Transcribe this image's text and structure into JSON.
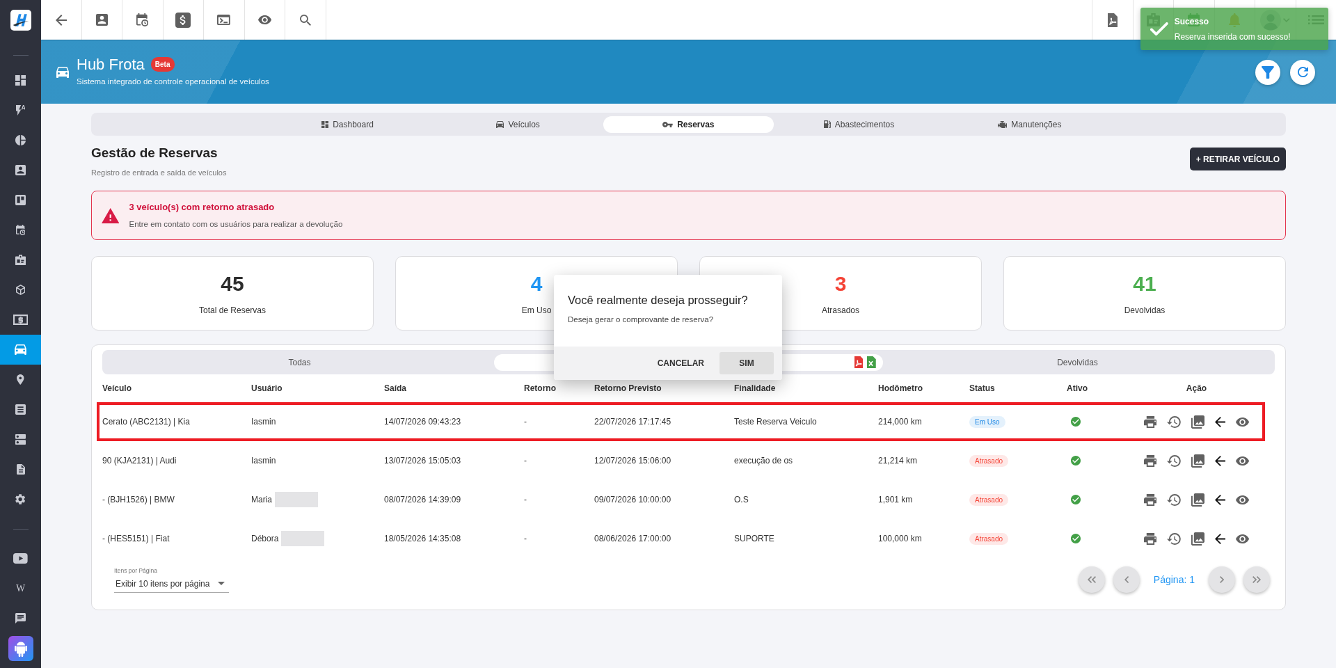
{
  "sidebar": {
    "items": [
      {
        "selected": false
      },
      {
        "selected": false
      },
      {
        "selected": false
      },
      {
        "selected": false
      },
      {
        "selected": false
      },
      {
        "selected": false
      },
      {
        "selected": false
      },
      {
        "selected": false
      },
      {
        "selected": false
      },
      {
        "selected": true
      },
      {
        "selected": false
      },
      {
        "selected": false
      },
      {
        "selected": false
      },
      {
        "selected": false
      },
      {
        "selected": false
      }
    ],
    "extra_items": [
      {
        "selected": false
      },
      {
        "selected": false,
        "glyph": "W"
      },
      {
        "selected": false
      },
      {
        "selected": false
      }
    ]
  },
  "toast": {
    "title": "Sucesso",
    "message": "Reserva inserida com sucesso!"
  },
  "header": {
    "title": "Hub Frota",
    "badge": "Beta",
    "subtitle": "Sistema integrado de controle operacional de veículos"
  },
  "module_tabs": [
    {
      "label": "Dashboard",
      "selected": false
    },
    {
      "label": "Veículos",
      "selected": false
    },
    {
      "label": "Reservas",
      "selected": true
    },
    {
      "label": "Abastecimentos",
      "selected": false
    },
    {
      "label": "Manutenções",
      "selected": false
    }
  ],
  "page": {
    "title": "Gestão de Reservas",
    "subtitle": "Registro de entrada e saída de veículos",
    "action_button": "+ RETIRAR VEÍCULO"
  },
  "alert": {
    "title": "3 veículo(s) com retorno atrasado",
    "message": "Entre em contato com os usuários para realizar a devolução"
  },
  "stats": [
    {
      "value": "45",
      "label": "Total de Reservas",
      "color": "#2d2d2d"
    },
    {
      "value": "4",
      "label": "Em Uso",
      "color": "#2196f3"
    },
    {
      "value": "3",
      "label": "Atrasados",
      "color": "#f44336"
    },
    {
      "value": "41",
      "label": "Devolvidas",
      "color": "#4caf50"
    }
  ],
  "dialog": {
    "title": "Você realmente deseja prosseguir?",
    "message": "Deseja gerar o comprovante de reserva?",
    "buttons": [
      {
        "label": "CANCELAR",
        "kind": "text"
      },
      {
        "label": "SIM",
        "kind": "filled"
      }
    ]
  },
  "filter_tabs": [
    {
      "label": "Todas",
      "selected": false
    },
    {
      "selected": true
    },
    {
      "label": "Devolvidas",
      "selected": false
    }
  ],
  "table": {
    "columns": [
      "Veículo",
      "Usuário",
      "Saída",
      "Retorno",
      "Retorno Previsto",
      "Finalidade",
      "Hodômetro",
      "Status",
      "Ativo",
      "Ação"
    ],
    "rows": [
      {
        "vehicle": "Cerato (ABC2131) | Kia",
        "user": "Iasmin",
        "user_redacted": false,
        "departure": "14/07/2026 09:43:23",
        "return": "-",
        "expected_return": "22/07/2026 17:17:45",
        "purpose": "Teste Reserva Veiculo",
        "odometer": "214,000 km",
        "status": {
          "label": "Em Uso",
          "color": "#1e88e5"
        },
        "active": true,
        "highlighted": true
      },
      {
        "vehicle": "90 (KJA2131) | Audi",
        "user": "Iasmin",
        "user_redacted": false,
        "departure": "13/07/2026 15:05:03",
        "return": "-",
        "expected_return": "12/07/2026 15:06:00",
        "purpose": "execução de os",
        "odometer": "21,214 km",
        "status": {
          "label": "Atrasado",
          "color": "#f44336"
        },
        "active": true,
        "highlighted": false
      },
      {
        "vehicle": "- (BJH1526) | BMW",
        "user": "Maria",
        "user_redacted": true,
        "departure": "08/07/2026 14:39:09",
        "return": "-",
        "expected_return": "09/07/2026 10:00:00",
        "purpose": "O.S",
        "odometer": "1,901 km",
        "status": {
          "label": "Atrasado",
          "color": "#f44336"
        },
        "active": true,
        "highlighted": false
      },
      {
        "vehicle": "- (HES5151) | Fiat",
        "user": "Débora",
        "user_redacted": true,
        "departure": "18/05/2026 14:35:08",
        "return": "-",
        "expected_return": "08/06/2026 17:00:00",
        "purpose": "SUPORTE",
        "odometer": "100,000 km",
        "status": {
          "label": "Atrasado",
          "color": "#f44336"
        },
        "active": true,
        "highlighted": false
      }
    ]
  },
  "page_size": {
    "label": "Itens por Página",
    "value": "Exibir 10 itens por página"
  },
  "pagination": {
    "label": "Página: 1"
  }
}
